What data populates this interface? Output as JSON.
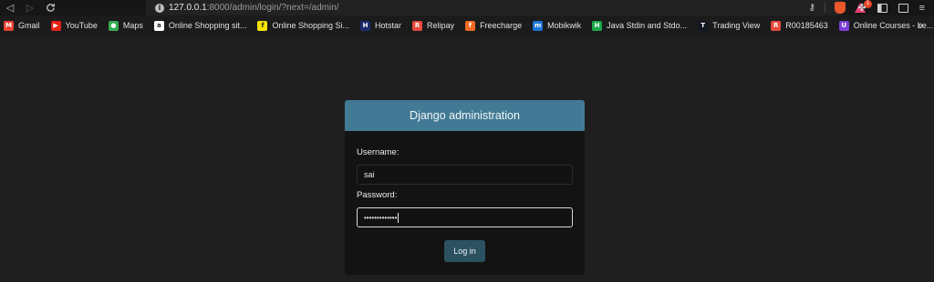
{
  "browser": {
    "url_host": "127.0.0.1",
    "url_rest": ":8000/admin/login/?next=/admin/",
    "rewards_count": "1"
  },
  "bookmarks": [
    {
      "label": "Gmail",
      "icon": "gmail-icon",
      "color": "#ea4335",
      "glyph": "M"
    },
    {
      "label": "YouTube",
      "icon": "youtube-icon",
      "color": "#e62117",
      "glyph": "▶"
    },
    {
      "label": "Maps",
      "icon": "maps-icon",
      "color": "#34a853",
      "glyph": "●"
    },
    {
      "label": "Online Shopping sit...",
      "icon": "amazon-icon",
      "color": "#ffffff",
      "glyph": "a"
    },
    {
      "label": "Online Shopping Si...",
      "icon": "flipkart-icon",
      "color": "#f7e300",
      "glyph": "f"
    },
    {
      "label": "Hotstar",
      "icon": "hotstar-icon",
      "color": "#1a2a6c",
      "glyph": "H"
    },
    {
      "label": "Relipay",
      "icon": "relipay-icon",
      "color": "#e54b3c",
      "glyph": "R"
    },
    {
      "label": "Freecharge",
      "icon": "freecharge-icon",
      "color": "#f26a24",
      "glyph": "f"
    },
    {
      "label": "Mobikwik",
      "icon": "mobikwik-icon",
      "color": "#1c74d4",
      "glyph": "m"
    },
    {
      "label": "Java Stdin and Stdo...",
      "icon": "hackerrank-icon",
      "color": "#1ba94c",
      "glyph": "H"
    },
    {
      "label": "Trading View",
      "icon": "tradingview-icon",
      "color": "#131722",
      "glyph": "T"
    },
    {
      "label": "R00185463",
      "icon": "relipay-icon",
      "color": "#e54b3c",
      "glyph": "R"
    },
    {
      "label": "Online Courses - Le...",
      "icon": "courses-icon",
      "color": "#7b3fd4",
      "glyph": "U"
    }
  ],
  "login": {
    "title": "Django administration",
    "username_label": "Username:",
    "username_value": "sai",
    "password_label": "Password:",
    "password_value": "•••••••••••••",
    "submit_label": "Log in"
  }
}
